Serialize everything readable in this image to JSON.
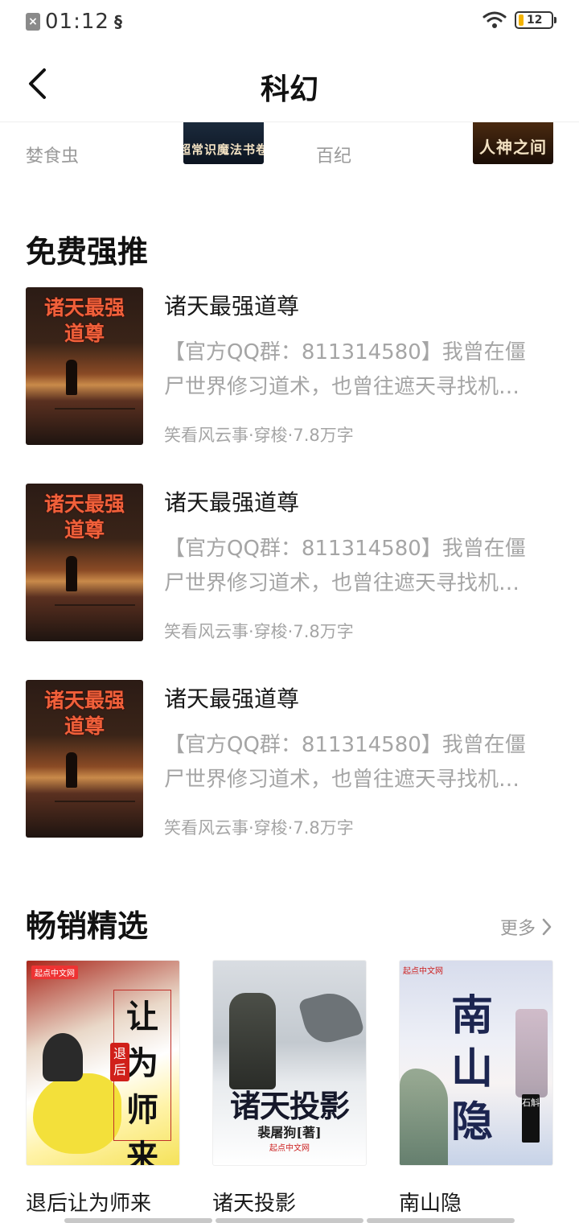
{
  "status_bar": {
    "time": "01:12",
    "battery_level": "12"
  },
  "nav": {
    "title": "科幻"
  },
  "peek_row": {
    "items": [
      {
        "author": "婪食虫",
        "cover_text": "超常识魔法书卷"
      },
      {
        "author": "百纪",
        "cover_text": "人神之间"
      }
    ]
  },
  "free_section": {
    "title": "免费强推",
    "books": [
      {
        "title": "诸天最强道尊",
        "cover_text_1": "诸天最强",
        "cover_text_2": "道尊",
        "desc_line_1": "【官方QQ群：811314580】我曾在僵",
        "desc_line_2": "尸世界修习道术，也曾往遮天寻找机…",
        "meta": "笑看风云事·穿梭·7.8万字"
      },
      {
        "title": "诸天最强道尊",
        "cover_text_1": "诸天最强",
        "cover_text_2": "道尊",
        "desc_line_1": "【官方QQ群：811314580】我曾在僵",
        "desc_line_2": "尸世界修习道术，也曾往遮天寻找机…",
        "meta": "笑看风云事·穿梭·7.8万字"
      },
      {
        "title": "诸天最强道尊",
        "cover_text_1": "诸天最强",
        "cover_text_2": "道尊",
        "desc_line_1": "【官方QQ群：811314580】我曾在僵",
        "desc_line_2": "尸世界修习道术，也曾往遮天寻找机…",
        "meta": "笑看风云事·穿梭·7.8万字"
      }
    ]
  },
  "bestseller_section": {
    "title": "畅销精选",
    "more_label": "更多",
    "books": [
      {
        "title": "退后让为师来",
        "cover_big": [
          "让",
          "为",
          "师",
          "来"
        ],
        "cover_seal": "退后",
        "cover_tag": "起点中文网"
      },
      {
        "title": "诸天投影",
        "cover_title": "诸天投影",
        "cover_author": "裴屠狗[著]",
        "cover_pub": "起点中文网"
      },
      {
        "title": "南山隐",
        "cover_title": "南山隐",
        "cover_author": "石斛",
        "cover_pub": "起点中文网"
      }
    ]
  }
}
